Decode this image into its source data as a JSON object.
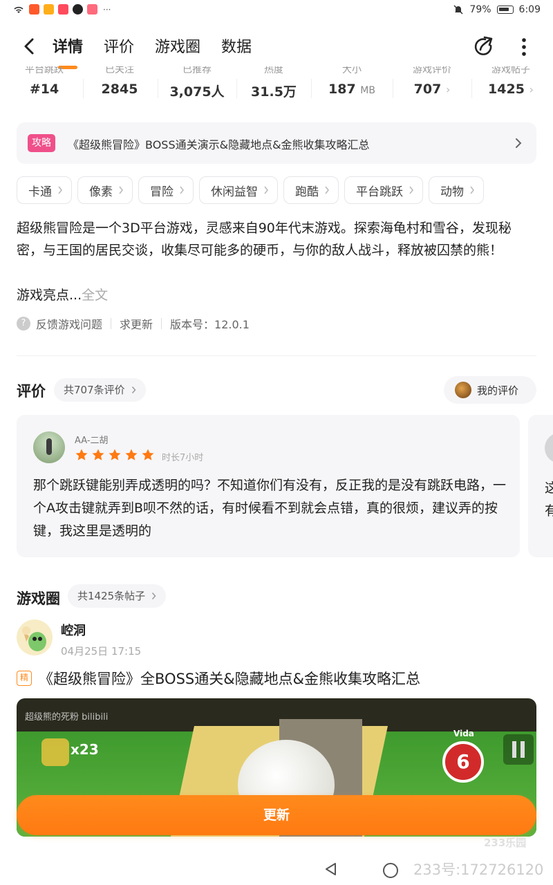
{
  "status": {
    "battery": "79%",
    "time": "6:09"
  },
  "nav": {
    "tabs": [
      {
        "label": "详情"
      },
      {
        "label": "评价"
      },
      {
        "label": "游戏圈"
      },
      {
        "label": "数据"
      }
    ]
  },
  "stats": [
    {
      "label": "平台跳跃",
      "value": "#14"
    },
    {
      "label": "已关注",
      "value": "2845"
    },
    {
      "label": "已推荐",
      "value": "3,075人"
    },
    {
      "label": "热度",
      "value": "31.5万"
    },
    {
      "label": "大小",
      "value": "187",
      "unit": "MB"
    },
    {
      "label": "游戏评价",
      "value": "707"
    },
    {
      "label": "游戏帖子",
      "value": "1425"
    }
  ],
  "banner": {
    "badge": "攻略",
    "text": "《超级熊冒险》BOSS通关演示&隐藏地点&金熊收集攻略汇总"
  },
  "tags": [
    "卡通",
    "像素",
    "冒险",
    "休闲益智",
    "跑酷",
    "平台跳跃",
    "动物"
  ],
  "description": {
    "text": "超级熊冒险是一个3D平台游戏，灵感来自90年代末游戏。探索海龟村和雪谷，发现秘密，与王国的居民交谈，收集尽可能多的硬币，与你的敌人战斗，释放被囚禁的熊！",
    "more_prefix": "游戏亮点...",
    "more_link": "全文"
  },
  "meta": {
    "feedback": "反馈游戏问题",
    "request_update": "求更新",
    "version": "版本号：12.0.1"
  },
  "reviews": {
    "title": "评价",
    "count_label": "共707条评价",
    "my_review": "我的评价",
    "items": [
      {
        "user": "AA-二胡",
        "stars": 5,
        "duration": "时长7小时",
        "text": "那个跳跃键能别弄成透明的吗？不知道你们有没有，反正我的是没有跳跃电路，一个A攻击键就弄到B呗不然的话，有时候看不到就会点错，真的很烦，建议弄的按键，我这里是透明的"
      }
    ],
    "peek_text_line1": "这",
    "peek_text_line2": "有"
  },
  "community": {
    "title": "游戏圈",
    "count_label": "共1425条帖子",
    "post": {
      "user": "崆洞",
      "time": "04月25日 17:15",
      "badge": "精",
      "title": "《超级熊冒险》全BOSS通关&隐藏地点&金熊收集攻略汇总",
      "thumb_watermark": "超级熊的死粉 bilibili",
      "thumb_coins": "x23",
      "thumb_vida": "Vida",
      "thumb_lives": "6"
    }
  },
  "update_button": "更新",
  "watermark": {
    "logo": "233乐园",
    "text": "233号:172726120"
  },
  "colors": {
    "accent": "#ff8a1c",
    "badge_pink": "#f0508a",
    "star": "#ff7a12"
  }
}
